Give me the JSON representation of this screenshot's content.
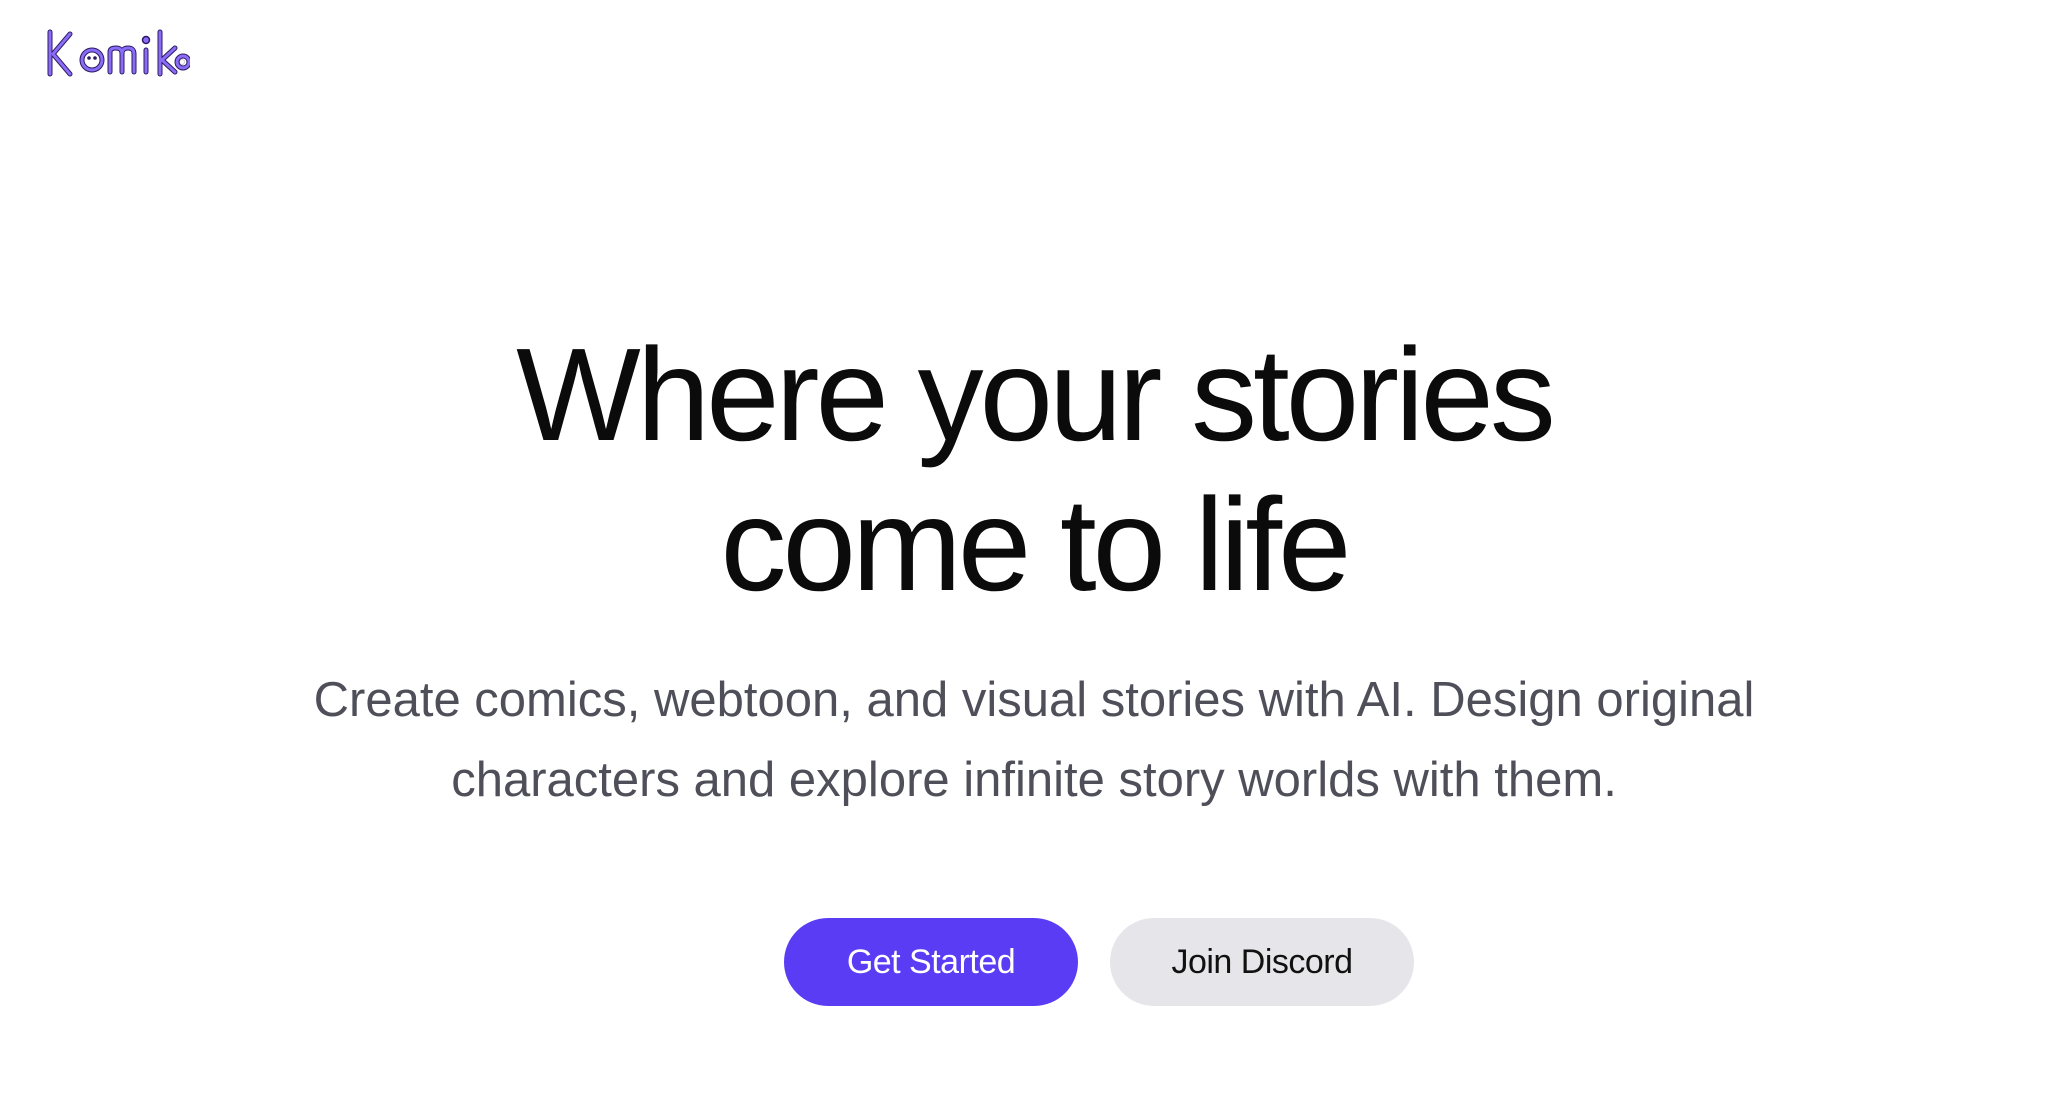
{
  "header": {
    "logo_text": "Komiko",
    "brand_color": "#7a5cf0"
  },
  "hero": {
    "headline_line1": "Where your stories",
    "headline_line2": "come to life",
    "subtitle_line1": "Create comics, webtoon, and visual stories with AI. Design original",
    "subtitle_line2": "characters and explore infinite story worlds with them.",
    "primary_button_label": "Get Started",
    "secondary_button_label": "Join Discord",
    "colors": {
      "headline": "#0b0b0b",
      "subtitle": "#4f4f5a",
      "primary_button_bg": "#5b3cf5",
      "primary_button_text": "#ffffff",
      "secondary_button_bg": "#e6e6ea",
      "secondary_button_text": "#111111"
    }
  }
}
